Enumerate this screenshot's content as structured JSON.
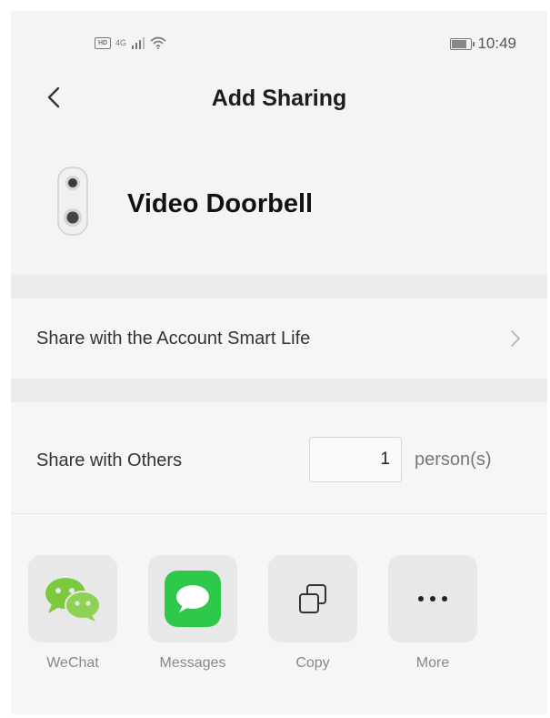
{
  "status_bar": {
    "network_badge": "HD",
    "network_type": "4G",
    "time": "10:49"
  },
  "header": {
    "title": "Add Sharing",
    "back_icon": "chevron-left-icon"
  },
  "device": {
    "name": "Video Doorbell",
    "icon": "doorbell-icon"
  },
  "share_account": {
    "label": "Share with the Account Smart Life",
    "icon": "chevron-right-icon"
  },
  "share_others": {
    "label": "Share with Others",
    "count": "1",
    "unit": "person(s)"
  },
  "share_targets": [
    {
      "label": "WeChat",
      "icon": "wechat-icon",
      "color": "#7bc93f"
    },
    {
      "label": "Messages",
      "icon": "messages-icon",
      "color": "#2ec94a"
    },
    {
      "label": "Copy",
      "icon": "copy-icon"
    },
    {
      "label": "More",
      "icon": "more-icon"
    }
  ],
  "colors": {
    "background": "#f4f4f4",
    "section_gap": "#ececec",
    "tile": "#e8e8e8"
  }
}
